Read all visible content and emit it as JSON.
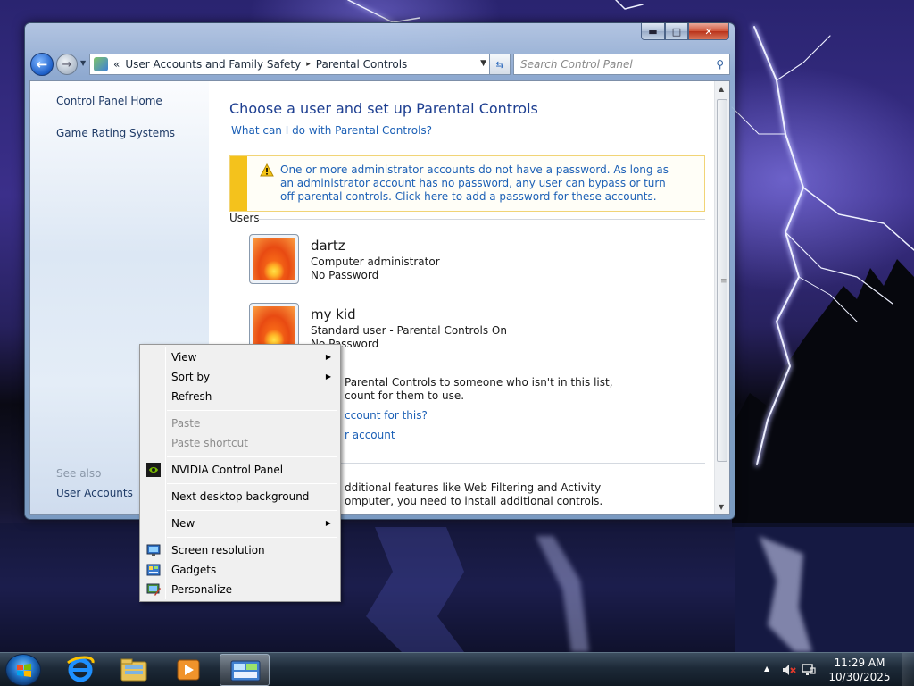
{
  "window": {
    "caption_buttons": {
      "minimize": "▬",
      "maximize": "□",
      "close": "✕"
    },
    "nav": {
      "breadcrumb_prefix": "«",
      "breadcrumb": [
        "User Accounts and Family Safety",
        "Parental Controls"
      ],
      "breadcrumb_sep": "▸",
      "search_placeholder": "Search Control Panel"
    },
    "help_label": "?"
  },
  "left_pane": {
    "links": [
      "Control Panel Home",
      "Game Rating Systems"
    ],
    "see_also_label": "See also",
    "see_also_links": [
      "User Accounts"
    ]
  },
  "main": {
    "title": "Choose a user and set up Parental Controls",
    "help_link": "What can I do with Parental Controls?",
    "warning": "One or more administrator accounts do not have a password. As long as an administrator account has no password, any user can bypass or turn off parental controls. Click here to add a password for these accounts.",
    "users_label": "Users",
    "users": [
      {
        "name": "dartz",
        "type": "Computer administrator",
        "password": "No Password"
      },
      {
        "name": "my kid",
        "type": "Standard user - Parental Controls On",
        "password": "No Password"
      }
    ],
    "apply_text_1": "Parental Controls to someone who isn't in this list,",
    "apply_text_2": "count for them to use.",
    "link_why": "ccount for this?",
    "link_create": "r account",
    "features_text_1": "dditional features like Web Filtering and Activity",
    "features_text_2": "omputer, you need to install additional controls."
  },
  "context_menu": {
    "items": [
      {
        "label": "View",
        "submenu": true,
        "disabled": false
      },
      {
        "label": "Sort by",
        "submenu": true,
        "disabled": false
      },
      {
        "label": "Refresh",
        "submenu": false,
        "disabled": false
      },
      {
        "label": "Paste",
        "submenu": false,
        "disabled": true
      },
      {
        "label": "Paste shortcut",
        "submenu": false,
        "disabled": true
      },
      {
        "label": "NVIDIA Control Panel",
        "submenu": false,
        "disabled": false,
        "icon": "nvidia-icon"
      },
      {
        "label": "Next desktop background",
        "submenu": false,
        "disabled": false
      },
      {
        "label": "New",
        "submenu": true,
        "disabled": false
      },
      {
        "label": "Screen resolution",
        "submenu": false,
        "disabled": false,
        "icon": "monitor-icon"
      },
      {
        "label": "Gadgets",
        "submenu": false,
        "disabled": false,
        "icon": "gadgets-icon"
      },
      {
        "label": "Personalize",
        "submenu": false,
        "disabled": false,
        "icon": "personalize-icon"
      }
    ],
    "submenu_arrow": "▶"
  },
  "taskbar": {
    "pinned": [
      "start-orb",
      "internet-explorer-icon",
      "windows-explorer-icon",
      "media-player-icon",
      "control-panel-icon"
    ],
    "clock_time": "11:29 AM",
    "clock_date": "10/30/2025",
    "tray_arrow": "▲"
  },
  "colors": {
    "link": "#1c60b6",
    "title": "#1e3f91",
    "warning_bar": "#f4c21c"
  }
}
